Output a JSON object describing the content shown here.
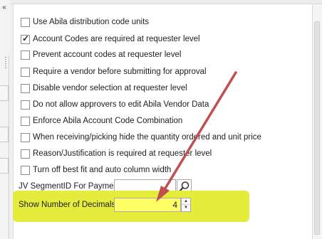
{
  "left_panel": {
    "collapse_glyph": "«",
    "tab_icons": [
      "tab-icon",
      "tab-icon",
      "tab-icon"
    ]
  },
  "options": [
    {
      "label": "Use Abila distribution code units",
      "checked": false
    },
    {
      "label": "Account Codes are required at requester level",
      "checked": true
    },
    {
      "label": "Prevent account codes at requester level",
      "checked": false
    },
    {
      "label": "Require a vendor before submitting for approval",
      "checked": false
    },
    {
      "label": "Disable vendor selection at requester level",
      "checked": false
    },
    {
      "label": "Do not allow approvers to edit Abila Vendor Data",
      "checked": false
    },
    {
      "label": "Enforce Abila Account Code Combination",
      "checked": false
    },
    {
      "label": "When receiving/picking hide the quantity ordered and unit price",
      "checked": false
    },
    {
      "label": "Reason/Justification is required at requester level",
      "checked": false
    },
    {
      "label": "Turn off best fit and auto column width",
      "checked": false
    }
  ],
  "jv_segment": {
    "label": "JV SegmentID For Payment",
    "value": "",
    "search_icon": "search-icon"
  },
  "decimals": {
    "label": "Show Number of Decimals",
    "value": "4"
  },
  "annotation": {
    "arrow_color": "#c0504d",
    "highlight_color": "#e6ec3c"
  }
}
